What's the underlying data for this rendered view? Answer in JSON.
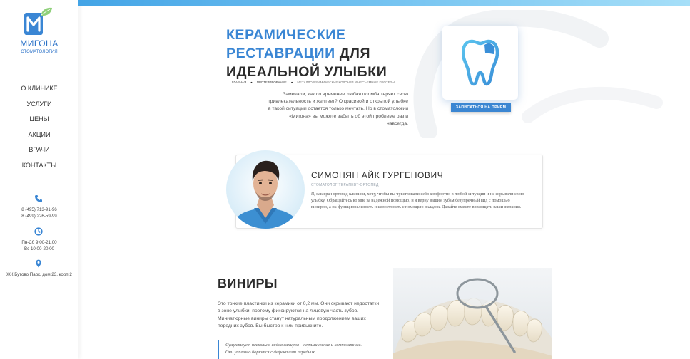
{
  "sidebar": {
    "logo": {
      "name": "МИГОНА",
      "subtitle": "СТОМАТОЛОГИЯ"
    },
    "nav": [
      {
        "label": "О КЛИНИКЕ"
      },
      {
        "label": "УСЛУГИ"
      },
      {
        "label": "ЦЕНЫ"
      },
      {
        "label": "АКЦИИ"
      },
      {
        "label": "ВРАЧИ"
      },
      {
        "label": "КОНТАКТЫ"
      }
    ],
    "contacts": {
      "phone_1": "8 (495) 713-91-96",
      "phone_2": "8 (499) 226-59-99",
      "hours_1": "Пн-Сб 9.00-21.00",
      "hours_2": "Вс 10.00-20.00",
      "address": "ЖК Бутово Парк, дом 23, корп 2"
    },
    "icons": {
      "phone": "phone-icon",
      "clock": "clock-icon",
      "location": "location-pin-icon"
    }
  },
  "hero": {
    "title_line1": "КЕРАМИЧЕСКИЕ",
    "title_line2_blue": "РЕСТАВРАЦИИ",
    "title_line2_dark": "ДЛЯ",
    "title_line3": "ИДЕАЛЬНОЙ УЛЫБКИ",
    "breadcrumb": [
      "ГЛАВНАЯ",
      "ПРОТЕЗИРОВАНИЕ",
      "МЕТАЛЛОКЕРАМИЧЕСКИЕ КОРОНКИ И НЕСЪЕМНЫЕ ПРОТЕЗЫ"
    ],
    "intro": "Замечали, как со временем любая пломба теряет свою привлекательность и желтеет? О красивой и открытой улыбке в такой ситуации остается только мечтать. Но в стоматологии «Мигона» вы можете забыть об этой проблеме раз и навсегда.",
    "appointment_button": "ЗАПИСАТЬСЯ НА ПРИЕМ",
    "card_icon": "tooth-icon"
  },
  "doctor": {
    "name": "СИМОНЯН АЙК ГУРГЕНОВИЧ",
    "role": "СТОМАТОЛОГ ТЕРАПЕВТ-ОРТОПЕД",
    "quote": "Я, как врач ортопед клиники, хочу, чтобы вы чувствовали себя комфортно в любой ситуации и не скрывали свою улыбку. Обращайтесь ко мне за надежной помощью, и я верну вашим зубам безупречный вид с помощью виниров, а их функциональность и целостность с помощью вкладок. Давайте вместе воплощать ваши желания."
  },
  "veneers": {
    "title": "ВИНИРЫ",
    "text": "Это тонкие пластинки из керамики от 0,2 мм. Они скрывают недостатки в зоне улыбки, поэтому фиксируются на лицевую часть зубов. Миниатюрные виниры станут натуральным продолжением ваших передних зубов. Вы быстро к ним привыкните.",
    "quote": "Существует несколько видов виниров – керамические и композитные. Они успешно борются с дефектами передних"
  },
  "colors": {
    "accent": "#3a86d4",
    "dark_text": "#2c2c2c",
    "topbar_start": "#43a4e6",
    "topbar_end": "#a6dff8"
  }
}
